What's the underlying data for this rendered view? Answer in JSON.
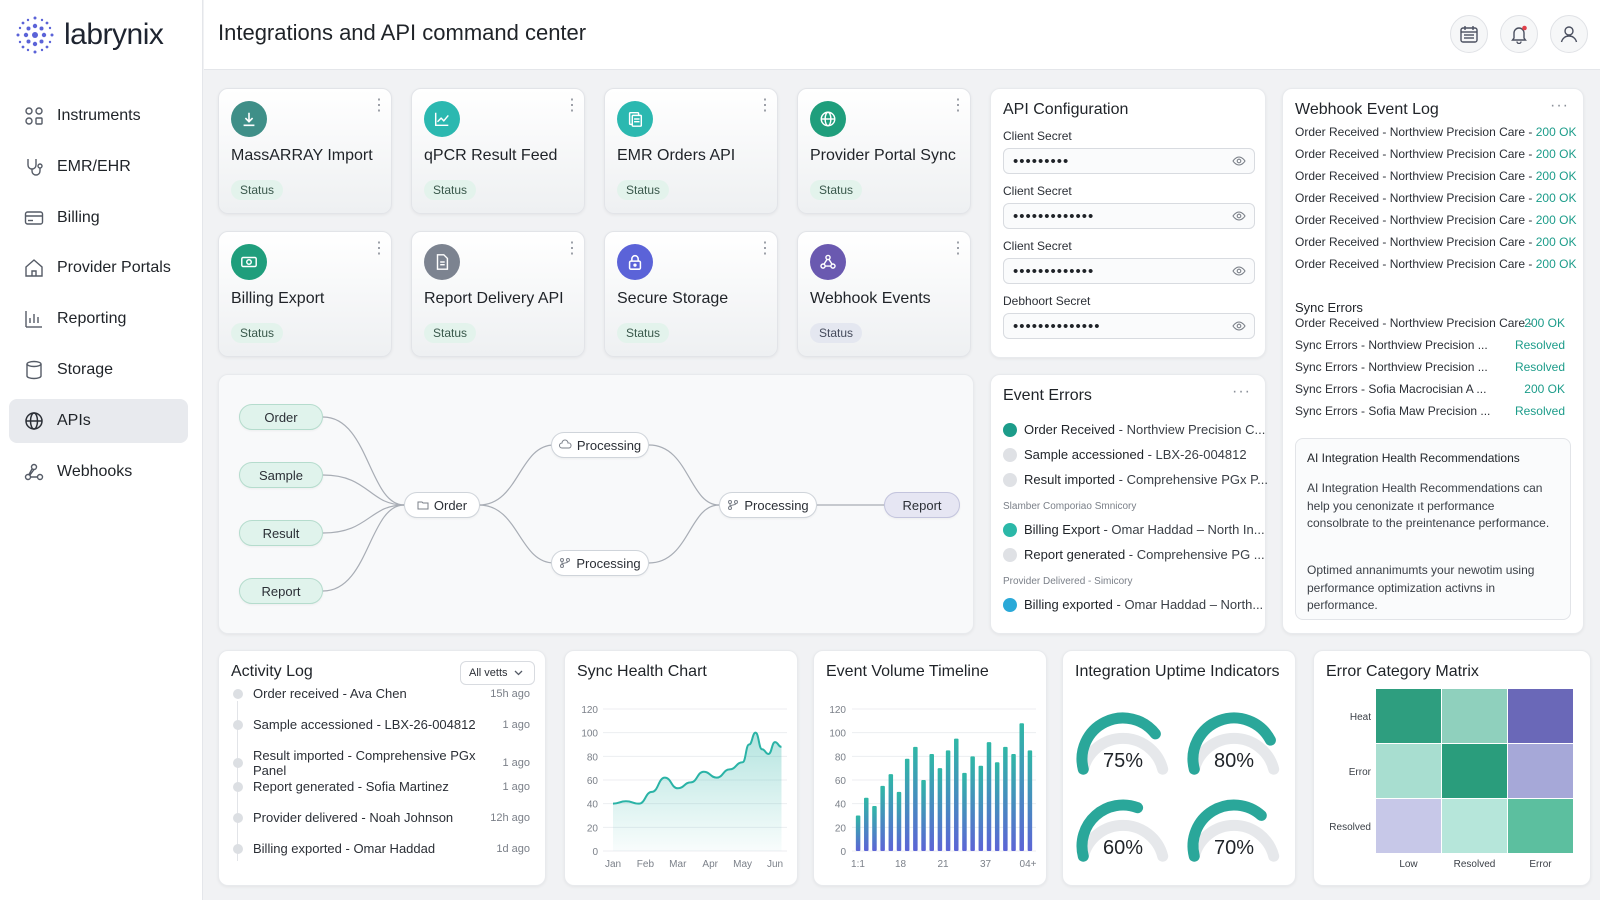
{
  "app": {
    "brand": "labrynix",
    "page_title": "Integrations and API command center"
  },
  "sidebar": {
    "items": [
      {
        "label": "Instruments",
        "icon": "instruments-icon"
      },
      {
        "label": "EMR/EHR",
        "icon": "stethoscope-icon"
      },
      {
        "label": "Billing",
        "icon": "card-icon"
      },
      {
        "label": "Provider Portals",
        "icon": "home-icon"
      },
      {
        "label": "Reporting",
        "icon": "bar-chart-icon"
      },
      {
        "label": "Storage",
        "icon": "database-icon"
      },
      {
        "label": "APIs",
        "icon": "globe-icon",
        "active": true
      },
      {
        "label": "Webhooks",
        "icon": "webhook-icon"
      }
    ]
  },
  "header": {
    "buttons": [
      "calendar-icon",
      "bell-icon",
      "user-icon"
    ]
  },
  "tiles": [
    {
      "name": "MassARRAY Import",
      "status": "Status",
      "color": "#3f8f88",
      "icon": "download-icon"
    },
    {
      "name": "qPCR Result Feed",
      "status": "Status",
      "color": "#2bb8b0",
      "icon": "line-chart-icon"
    },
    {
      "name": "EMR Orders API",
      "status": "Status",
      "color": "#2bb8b0",
      "icon": "document-icon"
    },
    {
      "name": "Provider Portal Sync",
      "status": "Status",
      "color": "#1f9e7c",
      "icon": "globe-icon"
    },
    {
      "name": "Billing Export",
      "status": "Status",
      "color": "#1f9e7c",
      "icon": "money-icon"
    },
    {
      "name": "Report Delivery API",
      "status": "Status",
      "color": "#7c8390",
      "icon": "file-icon"
    },
    {
      "name": "Secure Storage",
      "status": "Status",
      "color": "#5b63d8",
      "icon": "lock-icon"
    },
    {
      "name": "Webhook Events",
      "status": "Status",
      "color": "#6a59b0",
      "icon": "webhook-icon"
    }
  ],
  "flow": {
    "inputs": [
      "Order",
      "Sample",
      "Result",
      "Report"
    ],
    "hub": "Order",
    "mid_top": "Processing",
    "mid_bottom": "Processing",
    "merge": "Processing",
    "output": "Report"
  },
  "api_config": {
    "title": "API Configuration",
    "fields": [
      {
        "label": "Client Secret",
        "value": "•••••••••"
      },
      {
        "label": "Client Secret",
        "value": "•••••••••••••"
      },
      {
        "label": "Client Secret",
        "value": "•••••••••••••"
      },
      {
        "label": "Debhoort Secret",
        "value": "••••••••••••••"
      }
    ]
  },
  "event_errors": {
    "title": "Event Errors",
    "rows": [
      {
        "bold": "Order Received",
        "rest": " - Northview Precision C...",
        "color": "#1c9c8a"
      },
      {
        "bold": "Sample accessioned",
        "rest": " - LBX-26-004812",
        "color": "#dfe1e5"
      },
      {
        "bold": "Result imported",
        "rest": " - Comprehensive PGx P...",
        "color": "#dfe1e5"
      },
      {
        "sub": "Slamber Comporiao Smnicory"
      },
      {
        "bold": "Billing Export",
        "rest": " - Omar Haddad – North In...",
        "color": "#2bb8a8"
      },
      {
        "bold": "Report generated",
        "rest": " - Comprehensive PG ...",
        "color": "#dfe1e5"
      },
      {
        "sub": "Provider Delivered - Simicory"
      },
      {
        "bold": "Billing exported",
        "rest": " - Omar Haddad – North...",
        "color": "#2aa9d8"
      }
    ]
  },
  "webhook_log": {
    "title": "Webhook Event Log",
    "rows": [
      {
        "text": "Order Received - Northview Precision Care - ",
        "status": "200 OK"
      },
      {
        "text": "Order Received - Northview Precision Care - ",
        "status": "200 OK"
      },
      {
        "text": "Order Received - Northview Precision Care - ",
        "status": "200 OK"
      },
      {
        "text": "Order Received - Northview Precision Care - ",
        "status": "200 OK"
      },
      {
        "text": "Order Received - Northview Precision Care - ",
        "status": "200 OK"
      },
      {
        "text": "Order Received - Northview Precision Care - ",
        "status": "200 OK"
      },
      {
        "text": "Order Received - Northview Precision Care - ",
        "status": "200 OK"
      }
    ],
    "sync_title": "Sync Errors",
    "sync_rows": [
      {
        "text": "Order Received - Northview Precision Care - ",
        "status": "200 OK"
      },
      {
        "text": "Sync Errors - Northview Precision ...",
        "status": "Resolved"
      },
      {
        "text": "Sync Errors - Northview Precision ...",
        "status": "Resolved"
      },
      {
        "text": "Sync Errors - Sofia Macrocisian A ...",
        "status": "200 OK"
      },
      {
        "text": "Sync Errors - Sofia Maw Precision ...",
        "status": "Resolved"
      }
    ],
    "ai_title": "AI Integration Health Recommendations",
    "ai_p1": "AI Integration Health Recommendations can help you cenonizate ıt performance consolbrate to the preintenance performance.",
    "ai_p2": "Optimed annanimumts your newotim using performance optimization activns in performance."
  },
  "activity_log": {
    "title": "Activity Log",
    "filter": "All vetts",
    "rows": [
      {
        "text": "Order received - Ava Chen",
        "time": "15h ago"
      },
      {
        "text": "Sample accessioned - LBX-26-004812",
        "time": "1 ago"
      },
      {
        "text": "Result imported - Comprehensive PGx Panel",
        "time": "1 ago"
      },
      {
        "text": "Report generated - Sofia Martinez",
        "time": "1 ago"
      },
      {
        "text": "Provider delivered - Noah Johnson",
        "time": "12h ago"
      },
      {
        "text": "Billing exported - Omar Haddad",
        "time": "1d ago"
      }
    ]
  },
  "sync_chart": {
    "title": "Sync Health Chart",
    "chart_data": {
      "type": "area",
      "categories": [
        "Jan",
        "Feb",
        "Mar",
        "Apr",
        "May",
        "Jun"
      ],
      "ylim": [
        0,
        120
      ],
      "yticks": [
        0,
        20,
        40,
        60,
        80,
        100,
        120
      ],
      "x": [
        0,
        0.4,
        0.8,
        1.2,
        1.6,
        2.0,
        2.4,
        2.8,
        3.2,
        3.6,
        4.0,
        4.2,
        4.4,
        4.6,
        4.8,
        5.0,
        5.2
      ],
      "values": [
        40,
        42,
        40,
        50,
        62,
        53,
        58,
        67,
        62,
        69,
        75,
        90,
        100,
        86,
        82,
        92,
        88
      ],
      "color": "#2ab3a6"
    }
  },
  "volume_chart": {
    "title": "Event Volume Timeline",
    "chart_data": {
      "type": "bar",
      "xtick_labels": [
        "1:1",
        "18",
        "21",
        "37",
        "04+"
      ],
      "ylim": [
        0,
        120
      ],
      "yticks": [
        0,
        20,
        40,
        60,
        80,
        100,
        120
      ],
      "values": [
        30,
        45,
        38,
        55,
        65,
        50,
        78,
        88,
        60,
        82,
        70,
        85,
        95,
        66,
        80,
        72,
        92,
        75,
        88,
        82,
        108,
        85
      ],
      "color_top": "#2fb8a6",
      "color_bottom": "#5d64d6"
    }
  },
  "uptime": {
    "title": "Integration Uptime Indicators",
    "gauges": [
      {
        "label": "75%",
        "value": 75
      },
      {
        "label": "80%",
        "value": 80
      },
      {
        "label": "60%",
        "value": 60
      },
      {
        "label": "70%",
        "value": 70
      }
    ],
    "color": "#2aa79a"
  },
  "error_matrix": {
    "title": "Error Category Matrix",
    "rows": [
      "Heat",
      "Error",
      "Resolved"
    ],
    "cols": [
      "Low",
      "Resolved",
      "Error"
    ],
    "cells": [
      [
        "#2e9e7f",
        "#8fd0bd",
        "#6a68b8"
      ],
      [
        "#a8ded0",
        "#2a9d7c",
        "#a6a8d8"
      ],
      [
        "#c7c8e8",
        "#b6e6da",
        "#5cbf9f"
      ]
    ]
  }
}
